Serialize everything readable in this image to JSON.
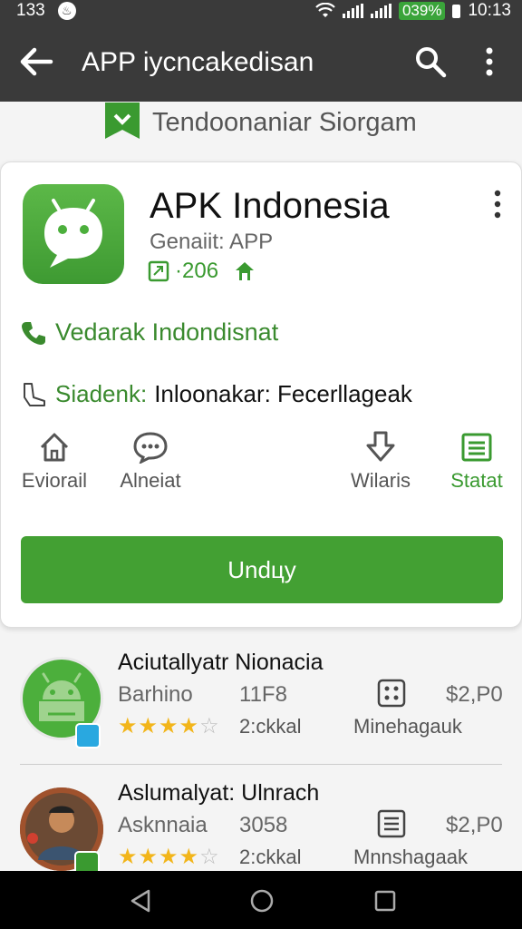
{
  "status_bar": {
    "time_left": "133",
    "notification_glyph": "♨",
    "battery": "039%",
    "clock": "10:13"
  },
  "app_bar": {
    "title": "APP iycncakedisan"
  },
  "section": {
    "title": "Tendoonaniar Siorgam"
  },
  "app": {
    "name": "APK Indonesia",
    "genre": "Genaiit: APP",
    "stat": "·206",
    "developer": "Vedarak Indondisnat",
    "category_label": "Siadenk:",
    "category_value": "Inloonakar: Fecerllageak",
    "icon_colors": {
      "primary": "#4caf3c",
      "dark": "#3e9a32"
    }
  },
  "actions": [
    {
      "label": "Eviorail",
      "icon": "home-icon"
    },
    {
      "label": "Alneiat",
      "icon": "chat-icon"
    },
    {
      "label": "Wilaris",
      "icon": "download-arrow-icon"
    },
    {
      "label": "Statat",
      "icon": "list-icon"
    }
  ],
  "download_button": {
    "label": "Undцy",
    "color": "#43a033"
  },
  "list_items": [
    {
      "title": "Aciutallyatr Nionacia",
      "developer": "Barhino",
      "count": "11F8",
      "rating": 4,
      "rating_label": "2:ckkal",
      "price": "$2,P0",
      "type": "Minehagauk"
    },
    {
      "title": "Aslumalyat: Ulnrach",
      "developer": "Asknnaia",
      "count": "3058",
      "rating": 4,
      "rating_label": "2:ckkal",
      "price": "$2,P0",
      "type": "Mnnshagaak"
    }
  ],
  "colors": {
    "accent": "#43a033",
    "header": "#3a3a3a",
    "star": "#f2b51a"
  }
}
